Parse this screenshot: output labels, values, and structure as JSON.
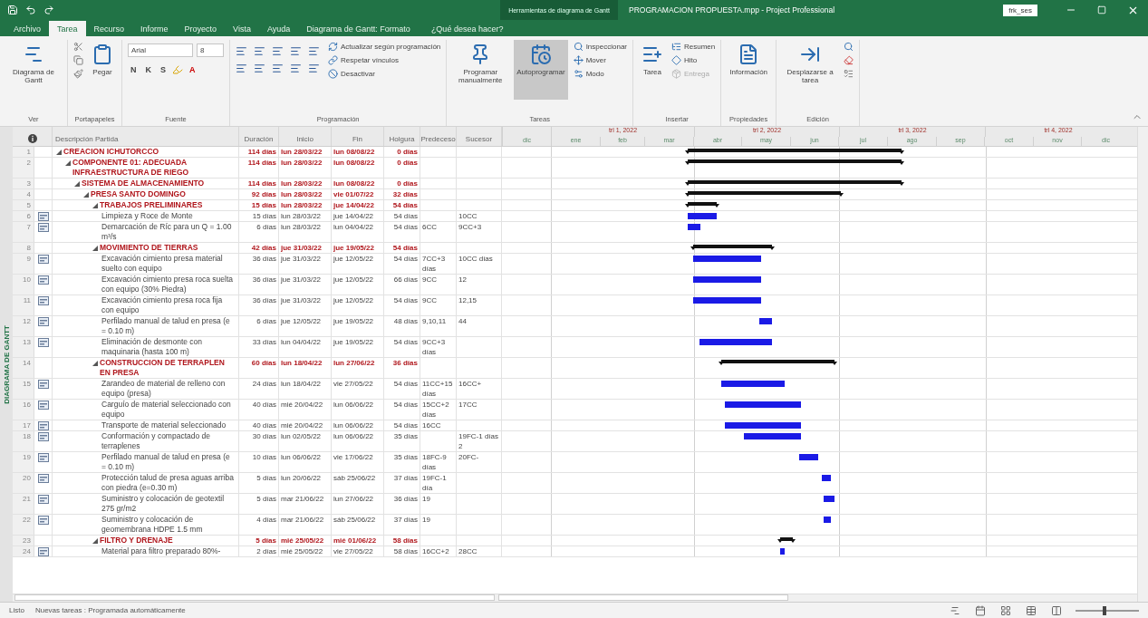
{
  "title_bar": {
    "context_label": "Herramientas de diagrama de Gantt",
    "title": "PROGRAMACION PROPUESTA.mpp  -  Project Professional",
    "user": "frk_ses"
  },
  "tabs": [
    {
      "label": "Archivo",
      "selected": false
    },
    {
      "label": "Tarea",
      "selected": true
    },
    {
      "label": "Recurso",
      "selected": false
    },
    {
      "label": "Informe",
      "selected": false
    },
    {
      "label": "Proyecto",
      "selected": false
    },
    {
      "label": "Vista",
      "selected": false
    },
    {
      "label": "Ayuda",
      "selected": false
    },
    {
      "label": "Diagrama de Gantt: Formato",
      "selected": false
    }
  ],
  "tell_me": "¿Qué desea hacer?",
  "ribbon": {
    "groups": [
      {
        "label": "Ver",
        "items": [
          {
            "kind": "large",
            "label": "Diagrama de Gantt",
            "selected": false
          }
        ]
      },
      {
        "label": "Portapapeles",
        "items": [
          {
            "kind": "large",
            "label": "Pegar",
            "selected": false
          }
        ]
      },
      {
        "label": "Fuente",
        "items": [
          {
            "kind": "font",
            "font": "Arial",
            "size": "8",
            "styles": [
              "N",
              "K",
              "S"
            ],
            "color_letter": "A"
          }
        ]
      },
      {
        "label": "Programación",
        "items": [
          {
            "kind": "align"
          },
          {
            "kind": "small",
            "label": "Actualizar según programación",
            "disabled": false
          },
          {
            "kind": "small",
            "label": "Respetar vínculos",
            "disabled": false
          },
          {
            "kind": "small",
            "label": "Desactivar",
            "disabled": false
          }
        ]
      },
      {
        "label": "Tareas",
        "items": [
          {
            "kind": "large",
            "label": "Programar manualmente",
            "selected": false
          },
          {
            "kind": "large",
            "label": "Autoprogramar",
            "selected": true
          },
          {
            "kind": "small",
            "label": "Inspeccionar",
            "disabled": false
          },
          {
            "kind": "small",
            "label": "Mover",
            "disabled": false
          },
          {
            "kind": "small",
            "label": "Modo",
            "disabled": false
          }
        ]
      },
      {
        "label": "Insertar",
        "items": [
          {
            "kind": "large",
            "label": "Tarea",
            "selected": false
          },
          {
            "kind": "small",
            "label": "Resumen",
            "disabled": false
          },
          {
            "kind": "small",
            "label": "Hito",
            "disabled": false
          },
          {
            "kind": "small",
            "label": "Entrega",
            "disabled": true
          }
        ]
      },
      {
        "label": "Propiedades",
        "items": [
          {
            "kind": "large",
            "label": "Información",
            "selected": false
          }
        ]
      },
      {
        "label": "Edición",
        "items": [
          {
            "kind": "large",
            "label": "Desplazarse a tarea",
            "selected": false
          }
        ]
      }
    ]
  },
  "side_label": "DIAGRAMA DE GANTT",
  "columns": [
    "Descripción Partida",
    "Duración",
    "Inicio",
    "Fin",
    "Holgura",
    "Predeceso",
    "Sucesor"
  ],
  "timeline": {
    "quarters": [
      "trl 1, 2022",
      "trl 2, 2022",
      "trl 3, 2022",
      "trl 4, 2022"
    ],
    "months": [
      "dic",
      "ene",
      "feb",
      "mar",
      "abr",
      "may",
      "jun",
      "jul",
      "ago",
      "sep",
      "oct",
      "nov",
      "dic"
    ]
  },
  "tasks": [
    {
      "id": "1",
      "kind": "summary",
      "expanded": true,
      "name": "CREACION ICHUTORCCO",
      "duration": "114 días",
      "start": "lun 28/03/22",
      "finish": "lun 08/08/22",
      "slack": "0 días",
      "children": [
        {
          "id": "2",
          "kind": "summary",
          "expanded": true,
          "name": "COMPONENTE 01: ADECUADA INFRAESTRUCTURA DE RIEGO",
          "duration": "114 días",
          "start": "lun 28/03/22",
          "finish": "lun 08/08/22",
          "slack": "0 días",
          "children": [
            {
              "id": "3",
              "kind": "summary",
              "expanded": true,
              "name": "SISTEMA DE ALMACENAMIENTO",
              "duration": "114 días",
              "start": "lun 28/03/22",
              "finish": "lun 08/08/22",
              "slack": "0 días",
              "children": [
                {
                  "id": "4",
                  "kind": "summary",
                  "expanded": true,
                  "name": "PRESA SANTO DOMINGO",
                  "duration": "92 días",
                  "start": "lun 28/03/22",
                  "finish": "vie 01/07/22",
                  "slack": "32 días",
                  "children": [
                    {
                      "id": "5",
                      "kind": "summary",
                      "expanded": true,
                      "name": "TRABAJOS PRELIMINARES",
                      "duration": "15 días",
                      "start": "lun 28/03/22",
                      "finish": "jue 14/04/22",
                      "slack": "54 días",
                      "children": [
                        {
                          "id": "6",
                          "kind": "task",
                          "name": "Limpieza y Roce de Monte",
                          "duration": "15 días",
                          "start": "lun 28/03/22",
                          "finish": "jue 14/04/22",
                          "slack": "54 días",
                          "successors": "10CC"
                        },
                        {
                          "id": "7",
                          "kind": "task",
                          "name": "Demarcación de Ríc para un Q = 1.00 m³/s",
                          "duration": "6 días",
                          "start": "lun 28/03/22",
                          "finish": "lun 04/04/22",
                          "slack": "54 días",
                          "predecessors": "6CC",
                          "successors": "9CC+3"
                        }
                      ]
                    },
                    {
                      "id": "8",
                      "kind": "summary",
                      "expanded": true,
                      "name": "MOVIMIENTO DE TIERRAS",
                      "duration": "42 días",
                      "start": "jue 31/03/22",
                      "finish": "jue 19/05/22",
                      "slack": "54 días",
                      "children": [
                        {
                          "id": "9",
                          "kind": "task",
                          "name": "Excavación cimiento presa material suelto con equipo",
                          "duration": "36 días",
                          "start": "jue 31/03/22",
                          "finish": "jue 12/05/22",
                          "slack": "54 días",
                          "predecessors": "7CC+3 días",
                          "successors": "10CC días"
                        },
                        {
                          "id": "10",
                          "kind": "task",
                          "name": "Excavación cimiento presa roca suelta con equipo (30% Piedra)",
                          "duration": "36 días",
                          "start": "jue 31/03/22",
                          "finish": "jue 12/05/22",
                          "slack": "66 días",
                          "predecessors": "9CC",
                          "successors": "12"
                        },
                        {
                          "id": "11",
                          "kind": "task",
                          "name": "Excavación cimiento presa roca fija con equipo",
                          "duration": "36 días",
                          "start": "jue 31/03/22",
                          "finish": "jue 12/05/22",
                          "slack": "54 días",
                          "predecessors": "9CC",
                          "successors": "12,15"
                        },
                        {
                          "id": "12",
                          "kind": "task",
                          "name": "Perfilado manual de talud en presa (e = 0.10 m)",
                          "duration": "6 días",
                          "start": "jue 12/05/22",
                          "finish": "jue 19/05/22",
                          "slack": "48 días",
                          "predecessors": "9,10,11",
                          "successors": "44"
                        },
                        {
                          "id": "13",
                          "kind": "task",
                          "name": "Eliminación de desmonte con maquinaria (hasta 100 m)",
                          "duration": "33 días",
                          "start": "lun 04/04/22",
                          "finish": "jue 19/05/22",
                          "slack": "54 días",
                          "predecessors": "9CC+3 días"
                        }
                      ]
                    },
                    {
                      "id": "14",
                      "kind": "summary",
                      "expanded": true,
                      "name": "CONSTRUCCION DE TERRAPLEN EN PRESA",
                      "duration": "60 días",
                      "start": "lun 18/04/22",
                      "finish": "lun 27/06/22",
                      "slack": "36 días",
                      "children": [
                        {
                          "id": "15",
                          "kind": "task",
                          "name": "Zarandeo de material de relleno con equipo (presa)",
                          "duration": "24 días",
                          "start": "lun 18/04/22",
                          "finish": "vie 27/05/22",
                          "slack": "54 días",
                          "predecessors": "11CC+15 días",
                          "successors": "16CC+"
                        },
                        {
                          "id": "16",
                          "kind": "task",
                          "name": "Carguío de material seleccionado con equipo",
                          "duration": "40 días",
                          "start": "mié 20/04/22",
                          "finish": "lun 06/06/22",
                          "slack": "54 días",
                          "predecessors": "15CC+2 días",
                          "successors": "17CC"
                        },
                        {
                          "id": "17",
                          "kind": "task",
                          "name": "Transporte de material seleccionado",
                          "duration": "40 días",
                          "start": "mié 20/04/22",
                          "finish": "lun 06/06/22",
                          "slack": "54 días",
                          "predecessors": "16CC"
                        },
                        {
                          "id": "18",
                          "kind": "task",
                          "name": "Conformación y compactado de terraplenes",
                          "duration": "30 días",
                          "start": "lun 02/05/22",
                          "finish": "lun 06/06/22",
                          "slack": "35 días",
                          "successors": "19FC-1 días 2"
                        },
                        {
                          "id": "19",
                          "kind": "task",
                          "name": "Perfilado manual de talud en presa (e = 0.10 m)",
                          "duration": "10 días",
                          "start": "lun 06/06/22",
                          "finish": "vie 17/06/22",
                          "slack": "35 días",
                          "predecessors": "18FC-9 días",
                          "successors": "20FC-"
                        },
                        {
                          "id": "20",
                          "kind": "task",
                          "name": "Protección talud de presa aguas arriba con piedra (e=0.30 m)",
                          "duration": "5 días",
                          "start": "lun 20/06/22",
                          "finish": "sáb 25/06/22",
                          "slack": "37 días",
                          "predecessors": "19FC-1 día"
                        },
                        {
                          "id": "21",
                          "kind": "task",
                          "name": "Suministro y colocación de geotextil 275 gr/m2",
                          "duration": "5 días",
                          "start": "mar 21/06/22",
                          "finish": "lun 27/06/22",
                          "slack": "36 días",
                          "predecessors": "19"
                        },
                        {
                          "id": "22",
                          "kind": "task",
                          "name": "Suministro y colocación de geomembrana HDPE 1.5 mm",
                          "duration": "4 días",
                          "start": "mar 21/06/22",
                          "finish": "sáb 25/06/22",
                          "slack": "37 días",
                          "predecessors": "19"
                        }
                      ]
                    },
                    {
                      "id": "23",
                      "kind": "summary",
                      "expanded": true,
                      "name": "FILTRO Y DRENAJE",
                      "duration": "5 días",
                      "start": "mié 25/05/22",
                      "finish": "mié 01/06/22",
                      "slack": "58 días",
                      "children": [
                        {
                          "id": "24",
                          "kind": "task",
                          "name": "Material para filtro preparado 80%-",
                          "duration": "2 días",
                          "start": "mié 25/05/22",
                          "finish": "vie 27/05/22",
                          "slack": "58 días",
                          "predecessors": "16CC+2",
                          "successors": "28CC"
                        }
                      ]
                    }
                  ]
                }
              ]
            }
          ]
        }
      ]
    }
  ],
  "status_bar": {
    "ready": "Listo",
    "new_tasks": "Nuevas tareas : Programada automáticamente",
    "zoom": {
      "level": 0.45
    }
  }
}
